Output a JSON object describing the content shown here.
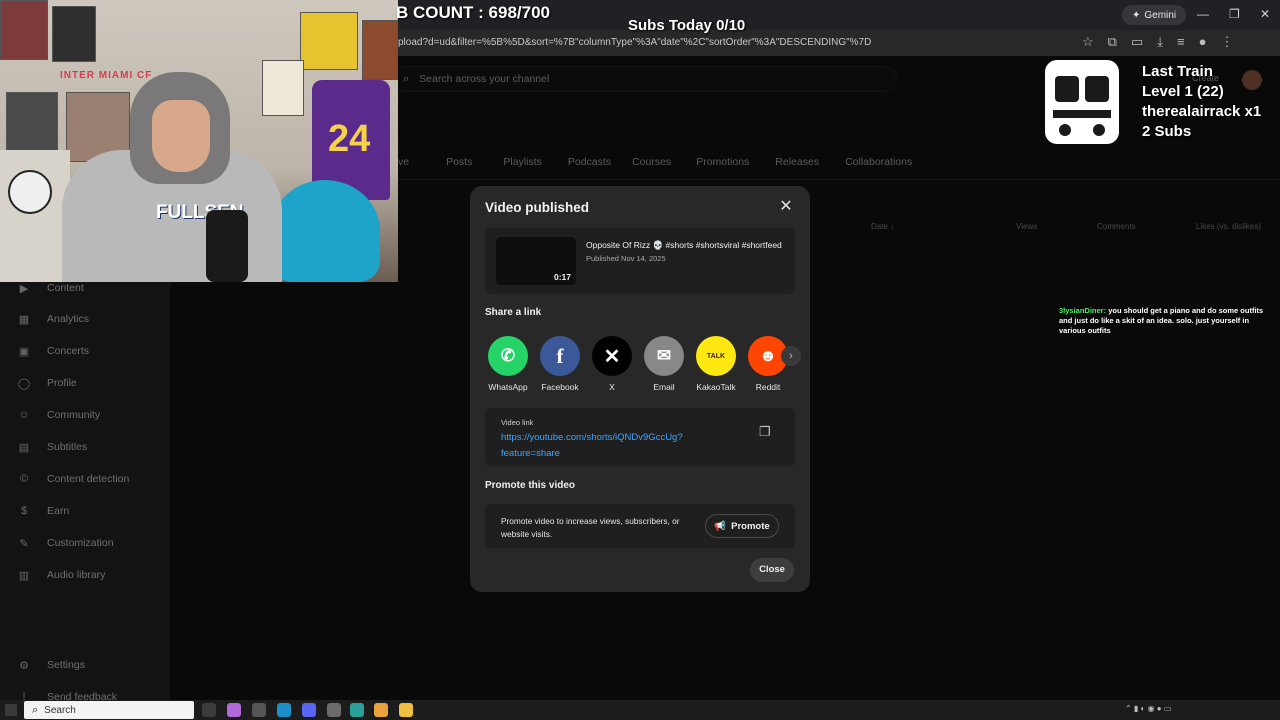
{
  "browser": {
    "url": "pload?d=ud&filter=%5B%5D&sort=%7B\"columnType\"%3A\"date\"%2C\"sortOrder\"%3A\"DESCENDING\"%7D",
    "gemini_label": "Gemini",
    "gemini_icon": "sparkle-icon"
  },
  "yt": {
    "search_placeholder": "Search across your channel",
    "create_label": "Create",
    "tabs": [
      "ve",
      "Posts",
      "Playlists",
      "Podcasts",
      "Courses",
      "Promotions",
      "Releases",
      "Collaborations"
    ],
    "table_headers": [
      "Date",
      "Views",
      "Comments",
      "Likes (vs. dislikes)"
    ],
    "sort_icon": "arrow-down-icon"
  },
  "sidebar": {
    "items": [
      {
        "label": "Content",
        "icon": "play-icon"
      },
      {
        "label": "Analytics",
        "icon": "analytics-icon"
      },
      {
        "label": "Concerts",
        "icon": "concerts-icon"
      },
      {
        "label": "Profile",
        "icon": "profile-icon"
      },
      {
        "label": "Community",
        "icon": "community-icon"
      },
      {
        "label": "Subtitles",
        "icon": "subtitles-icon"
      },
      {
        "label": "Content detection",
        "icon": "copyright-icon"
      },
      {
        "label": "Earn",
        "icon": "dollar-icon"
      },
      {
        "label": "Customization",
        "icon": "wand-icon"
      },
      {
        "label": "Audio library",
        "icon": "audio-library-icon"
      }
    ],
    "settings_label": "Settings",
    "feedback_label": "Send feedback"
  },
  "overlay": {
    "sub_count": "B COUNT : 698/700",
    "subs_today": "Subs Today 0/10",
    "train_title": "Last Train",
    "train_level": "Level 1  (22)",
    "train_user": "therealairrack x1",
    "train_subs": "2 Subs",
    "chat_user": "3lysianDiner:",
    "chat_message": "you should get a piano and do some outfits and just do like a skit of an idea. solo. just yourself in various outfits"
  },
  "webcam": {
    "jersey_number": "24",
    "hoodie_text": "FULLSEN",
    "banner_text": "INTER MIAMI CF"
  },
  "modal": {
    "title": "Video published",
    "video_title": "Opposite Of Rizz 💀 #shorts #shortsviral #shortfeed",
    "duration": "0:17",
    "published": "Published Nov 14, 2025",
    "share_heading": "Share a link",
    "share_targets": [
      {
        "label": "WhatsApp",
        "icon": "whatsapp-icon",
        "color": "#25D366",
        "glyph": "✆"
      },
      {
        "label": "Facebook",
        "icon": "facebook-icon",
        "color": "#3b5998",
        "glyph": "f"
      },
      {
        "label": "X",
        "icon": "x-icon",
        "color": "#000000",
        "glyph": "𝕏"
      },
      {
        "label": "Email",
        "icon": "email-icon",
        "color": "#888888",
        "glyph": "✉"
      },
      {
        "label": "KakaoTalk",
        "icon": "kakaotalk-icon",
        "color": "#FFE812",
        "glyph": "TALK"
      },
      {
        "label": "Reddit",
        "icon": "reddit-icon",
        "color": "#FF4500",
        "glyph": "👽"
      }
    ],
    "video_link_label": "Video link",
    "video_link": "https://youtube.com/shorts/iQNDv9GccUg?feature=share",
    "promote_heading": "Promote this video",
    "promote_text": "Promote video to increase views, subscribers, or website visits.",
    "promote_button": "Promote",
    "close_button": "Close"
  },
  "taskbar": {
    "search_label": "Search"
  }
}
